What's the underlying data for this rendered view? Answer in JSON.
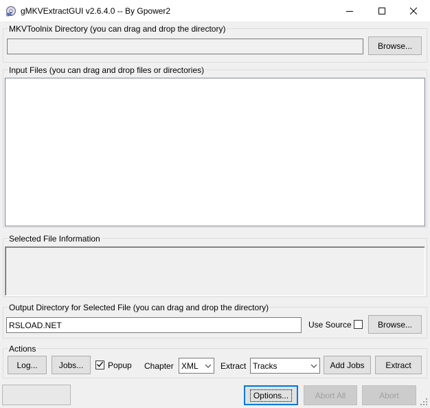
{
  "window": {
    "title": "gMKVExtractGUI v2.6.4.0 -- By Gpower2",
    "icon": "app-icon",
    "controls": [
      "minimize-icon",
      "maximize-icon",
      "close-icon"
    ]
  },
  "mkvtoolnix": {
    "label": "MKVToolnix Directory (you can drag and drop the directory)",
    "path_value": "",
    "browse_label": "Browse..."
  },
  "input_files": {
    "label": "Input Files (you can drag and drop files or directories)",
    "items": []
  },
  "selected_info": {
    "label": "Selected File Information",
    "text": ""
  },
  "output": {
    "label": "Output Directory for Selected File (you can drag and drop the directory)",
    "path_value": "RSLOAD.NET",
    "use_source_label": "Use Source",
    "use_source_checked": false,
    "browse_label": "Browse..."
  },
  "actions": {
    "label": "Actions",
    "log_label": "Log...",
    "jobs_label": "Jobs...",
    "popup_label": "Popup",
    "popup_checked": true,
    "chapter_label": "Chapter",
    "chapter_value": "XML",
    "extract_label": "Extract",
    "extract_value": "Tracks",
    "add_jobs_label": "Add Jobs",
    "extract_button_label": "Extract"
  },
  "bottom": {
    "options_label": "Options...",
    "abort_all_label": "Abort All",
    "abort_label": "Abort"
  }
}
